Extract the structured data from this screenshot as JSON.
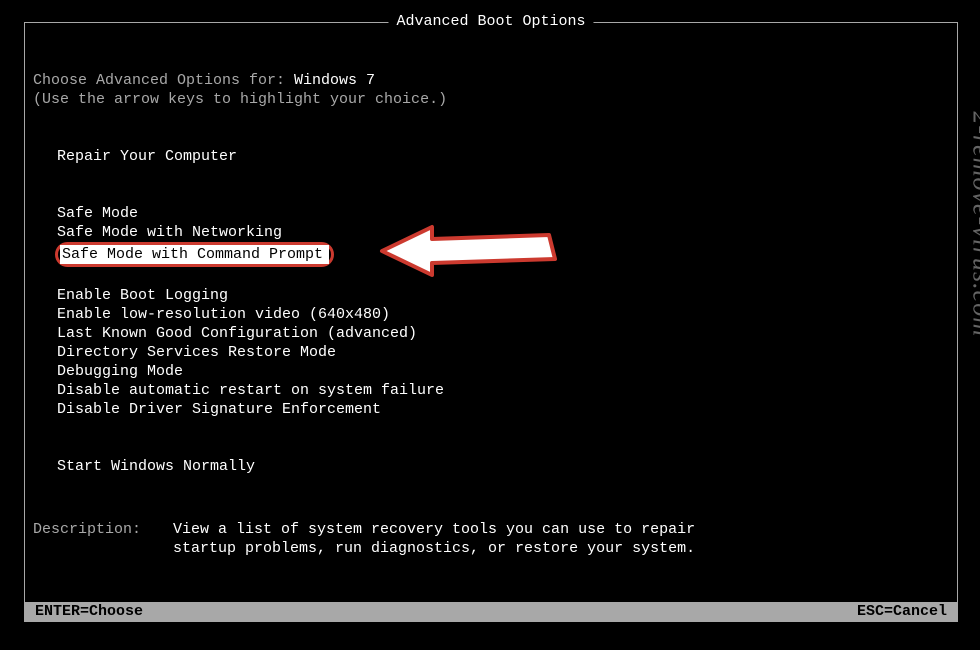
{
  "title": "Advanced Boot Options",
  "choose_prefix": "Choose Advanced Options for: ",
  "os_name": "Windows 7",
  "instruction": "(Use the arrow keys to highlight your choice.)",
  "groups": [
    {
      "items": [
        "Repair Your Computer"
      ]
    },
    {
      "items": [
        "Safe Mode",
        "Safe Mode with Networking",
        "Safe Mode with Command Prompt"
      ]
    },
    {
      "items": [
        "Enable Boot Logging",
        "Enable low-resolution video (640x480)",
        "Last Known Good Configuration (advanced)",
        "Directory Services Restore Mode",
        "Debugging Mode",
        "Disable automatic restart on system failure",
        "Disable Driver Signature Enforcement"
      ]
    },
    {
      "items": [
        "Start Windows Normally"
      ]
    }
  ],
  "selected": "Safe Mode with Command Prompt",
  "description": {
    "label": "Description:",
    "line1": "View a list of system recovery tools you can use to repair",
    "line2": "startup problems, run diagnostics, or restore your system."
  },
  "footer": {
    "left": "ENTER=Choose",
    "right": "ESC=Cancel"
  },
  "watermark": "2-remove-virus.com"
}
